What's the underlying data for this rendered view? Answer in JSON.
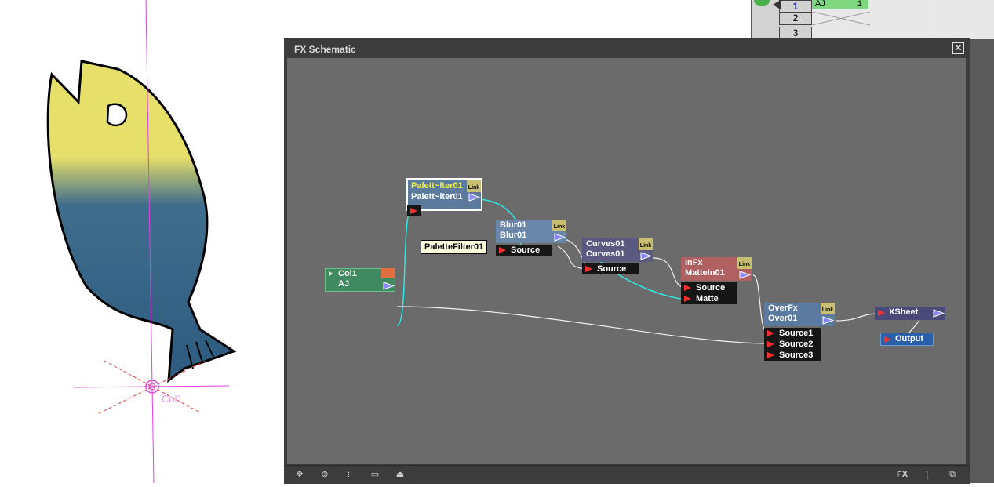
{
  "viewer": {
    "column_label": "Col1"
  },
  "xsheet": {
    "rows": [
      {
        "frame": "1",
        "level": "AJ",
        "cell": "1"
      },
      {
        "frame": "2"
      },
      {
        "frame": "3"
      }
    ]
  },
  "fx_schematic": {
    "title": "FX Schematic",
    "tooltip": "PaletteFilter01",
    "nodes": {
      "palette": {
        "line1": "Palett~lter01",
        "line2": "Palett~lter01",
        "link": "Link"
      },
      "blur": {
        "line1": "Blur01",
        "line2": "Blur01",
        "link": "Link",
        "ports": [
          "Source"
        ]
      },
      "curves": {
        "line1": "Curves01",
        "line2": "Curves01",
        "link": "Link",
        "ports": [
          "Source"
        ]
      },
      "infx": {
        "line1": "InFx",
        "line2": "MatteIn01",
        "link": "Link",
        "ports": [
          "Source",
          "Matte"
        ]
      },
      "overfx": {
        "line1": "OverFx",
        "line2": "Over01",
        "link": "Link",
        "ports": [
          "Source1",
          "Source2",
          "Source3"
        ]
      },
      "col1": {
        "line1": "Col1",
        "line2": "AJ"
      },
      "xsheet": {
        "label": "XSheet"
      },
      "output": {
        "label": "Output"
      }
    },
    "toolbar_right": {
      "fx_label": "FX"
    }
  },
  "colors": {
    "canvas": "#6b6b6b",
    "wire": "#f0f0f0",
    "selected_wire": "#2ee8e0"
  }
}
